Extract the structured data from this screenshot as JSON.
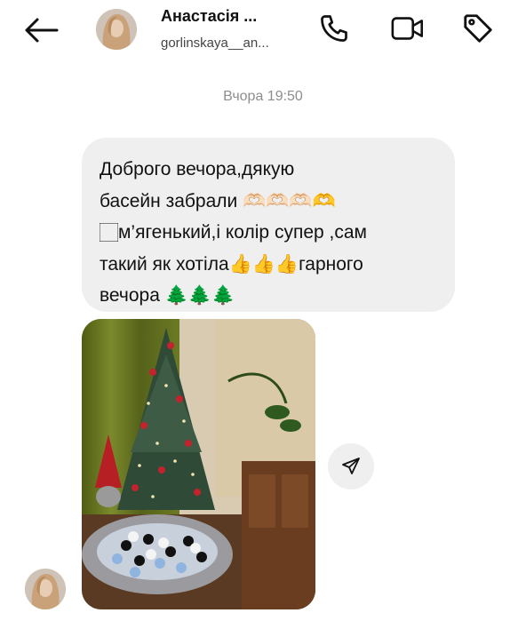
{
  "header": {
    "contact_name": "Анастасія ...",
    "username": "gorlinskaya__an..."
  },
  "timestamp": "Вчора 19:50",
  "message": {
    "text": "Доброго вечора,дякую\nбасейн забрали 🫶🏻🫶🏻🫶🏻🫶\n🏻м’ягенький,і колір супер ,сам\nтакий як хотіла👍👍👍гарного\nвечора 🌲🌲🌲"
  },
  "icons": {
    "back": "arrow-left-icon",
    "call": "phone-icon",
    "video": "video-camera-icon",
    "tag": "tag-icon",
    "share": "send-icon"
  }
}
